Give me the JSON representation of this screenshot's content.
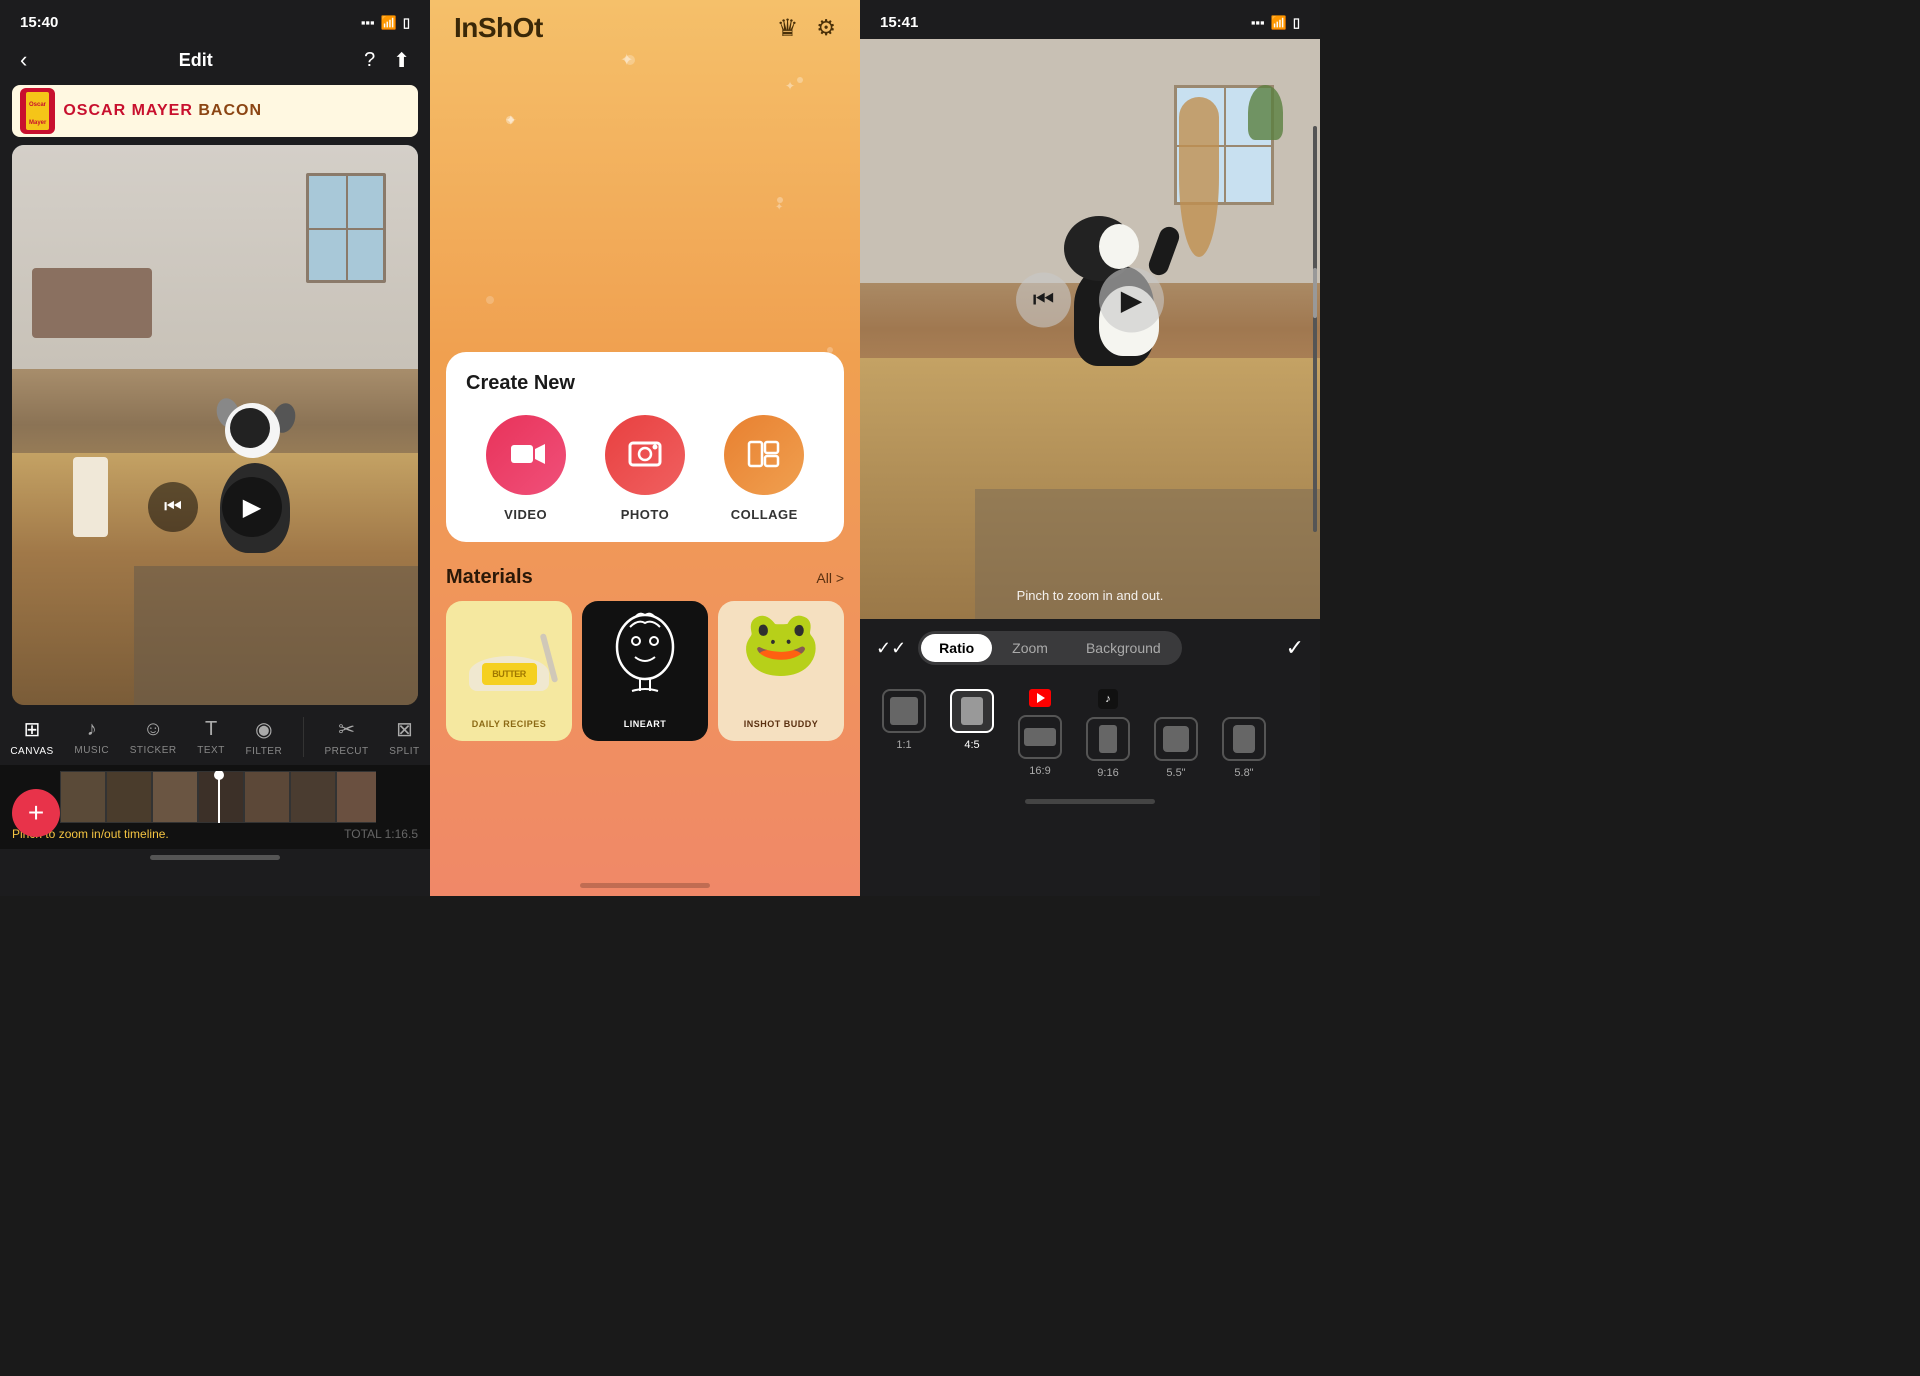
{
  "panel1": {
    "statusbar": {
      "time": "15:40",
      "arrow": "↗"
    },
    "nav": {
      "back": "‹",
      "title": "Edit",
      "help": "?",
      "share": "⬆"
    },
    "ad": {
      "brand": "OSCAR MAYER",
      "product": "BACON"
    },
    "controls": {
      "rewind": "⏮",
      "play": "▶"
    },
    "toolbar": {
      "items": [
        {
          "icon": "≡",
          "label": "CANVAS",
          "active": true
        },
        {
          "icon": "♪",
          "label": "MUSIC",
          "active": false
        },
        {
          "icon": "☺",
          "label": "STICKER",
          "active": false
        },
        {
          "icon": "T",
          "label": "TEXT",
          "active": false
        },
        {
          "icon": "◎",
          "label": "FILTER",
          "active": false
        },
        {
          "icon": "✂",
          "label": "PRECUT",
          "active": false
        },
        {
          "icon": "⊠",
          "label": "SPLIT",
          "active": false
        }
      ]
    },
    "timeline": {
      "hint": "Pinch to zoom in/out timeline.",
      "total": "TOTAL 1:16.5",
      "add": "+"
    }
  },
  "panel2": {
    "statusbar": {
      "time": "",
      "arrow": ""
    },
    "header": {
      "logo": "InShOt",
      "crown_icon": "♛",
      "settings_icon": "⚙"
    },
    "create": {
      "title": "Create New",
      "buttons": [
        {
          "icon": "▤",
          "label": "VIDEO"
        },
        {
          "icon": "⊞",
          "label": "PHOTO"
        },
        {
          "icon": "◫",
          "label": "COLLAGE"
        }
      ]
    },
    "materials": {
      "title": "Materials",
      "all": "All >",
      "cards": [
        {
          "label": "DAILY RECIPES",
          "emoji": "🧈",
          "theme": "daily"
        },
        {
          "label": "LINEART",
          "emoji": "◉",
          "theme": "lineart"
        },
        {
          "label": "INSHOT BUDDY",
          "emoji": "🐸",
          "theme": "inshot"
        }
      ]
    }
  },
  "panel3": {
    "statusbar": {
      "time": "15:41",
      "arrow": "↗"
    },
    "hint": "Pinch to zoom in and out.",
    "toolbar": {
      "double_check": "✓✓",
      "tabs": [
        {
          "label": "Ratio",
          "active": true
        },
        {
          "label": "Zoom",
          "active": false
        },
        {
          "label": "Background",
          "active": false
        }
      ],
      "check": "✓"
    },
    "ratio_options": [
      {
        "label": "1:1",
        "active": false,
        "shape": "square"
      },
      {
        "label": "4:5",
        "active": true,
        "shape": "portrait"
      },
      {
        "label": "16:9",
        "active": false,
        "shape": "landscape"
      },
      {
        "label": "9:16",
        "active": false,
        "shape": "tall"
      },
      {
        "label": "5.5\"",
        "active": false,
        "shape": "phone"
      },
      {
        "label": "5.8\"",
        "active": false,
        "shape": "phone"
      }
    ],
    "controls": {
      "rewind": "⏮",
      "play": "▶"
    }
  }
}
